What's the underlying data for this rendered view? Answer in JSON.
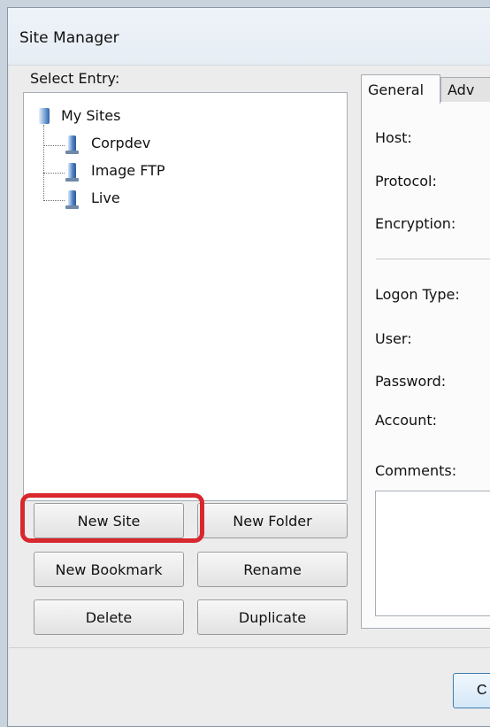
{
  "window": {
    "title": "Site Manager"
  },
  "left": {
    "select_entry_label": "Select Entry:",
    "tree": {
      "root": "My Sites",
      "children": [
        "Corpdev",
        "Image FTP",
        "Live"
      ]
    },
    "buttons": {
      "new_site": "New Site",
      "new_folder": "New Folder",
      "new_bookmark": "New Bookmark",
      "rename": "Rename",
      "delete": "Delete",
      "duplicate": "Duplicate"
    }
  },
  "right": {
    "tabs": [
      "General",
      "Adv"
    ],
    "fields": {
      "host": "Host:",
      "protocol": "Protocol:",
      "encryption": "Encryption:",
      "logon_type": "Logon Type:",
      "user": "User:",
      "password": "Password:",
      "account": "Account:",
      "comments": "Comments:"
    }
  },
  "footer": {
    "partial_button": "C"
  },
  "colors": {
    "highlight": "#d9272e",
    "icon_blue": "#4a7fc0"
  },
  "icons": [
    "folder-icon",
    "server-icon"
  ]
}
